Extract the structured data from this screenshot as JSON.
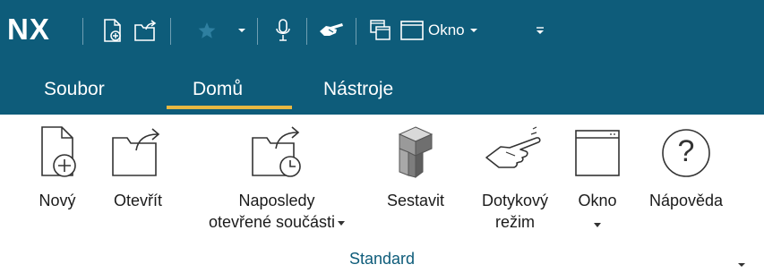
{
  "app": {
    "logo": "NX"
  },
  "quick_access": {
    "window_label": "Okno"
  },
  "tabs": [
    {
      "label": "Soubor"
    },
    {
      "label": "Domů",
      "active": true
    },
    {
      "label": "Nástroje"
    }
  ],
  "ribbon": {
    "buttons": [
      {
        "label": "Nový"
      },
      {
        "label": "Otevřít"
      },
      {
        "label_line1": "Naposledy",
        "label_line2": "otevřené součásti"
      },
      {
        "label": "Sestavit"
      },
      {
        "label_line1": "Dotykový",
        "label_line2": "režim"
      },
      {
        "label": "Okno"
      },
      {
        "label": "Nápověda",
        "glyph": "?"
      }
    ],
    "group_label": "Standard"
  },
  "colors": {
    "titlebar": "#0e5c7a",
    "active_tab_underline": "#e9b842",
    "group_label": "#0e5c7a"
  }
}
